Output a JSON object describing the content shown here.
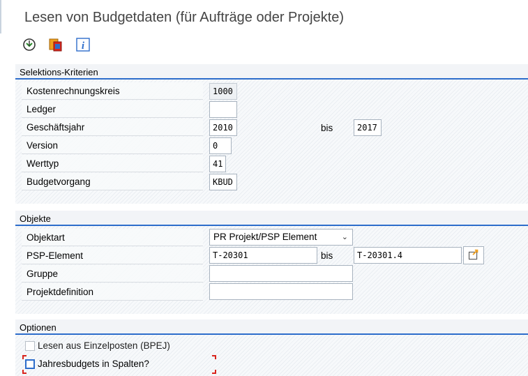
{
  "window": {
    "title": "Lesen von Budgetdaten (für Aufträge oder Projekte)"
  },
  "toolbar": {
    "buttons": [
      {
        "icon": "execute-icon"
      },
      {
        "icon": "variants-icon"
      },
      {
        "icon": "info-icon"
      }
    ]
  },
  "selection": {
    "header": "Selektions-Kriterien",
    "kostenrechnungskreis": {
      "label": "Kostenrechnungskreis",
      "value": "1000"
    },
    "ledger": {
      "label": "Ledger",
      "value": ""
    },
    "geschaeftsjahr": {
      "label": "Geschäftsjahr",
      "from": "2010",
      "bis": "bis",
      "to": "2017"
    },
    "version": {
      "label": "Version",
      "value": "0"
    },
    "werttyp": {
      "label": "Werttyp",
      "value": "41"
    },
    "budgetvorgang": {
      "label": "Budgetvorgang",
      "value": "KBUD"
    }
  },
  "objects": {
    "header": "Objekte",
    "objektart": {
      "label": "Objektart",
      "value": "PR Projekt/PSP Element"
    },
    "psp": {
      "label": "PSP-Element",
      "from": "T-20301",
      "bis": "bis",
      "to": "T-20301.4"
    },
    "gruppe": {
      "label": "Gruppe",
      "value": ""
    },
    "projektdefinition": {
      "label": "Projektdefinition",
      "value": ""
    }
  },
  "options": {
    "header": "Optionen",
    "einzelposten": {
      "label": "Lesen aus Einzelposten (BPEJ)",
      "checked": false
    },
    "jahresbudgets": {
      "label": "Jahresbudgets in Spalten?",
      "checked": false
    }
  },
  "colors": {
    "accent": "#2d6dcb",
    "focus_marker": "#d9241c"
  }
}
